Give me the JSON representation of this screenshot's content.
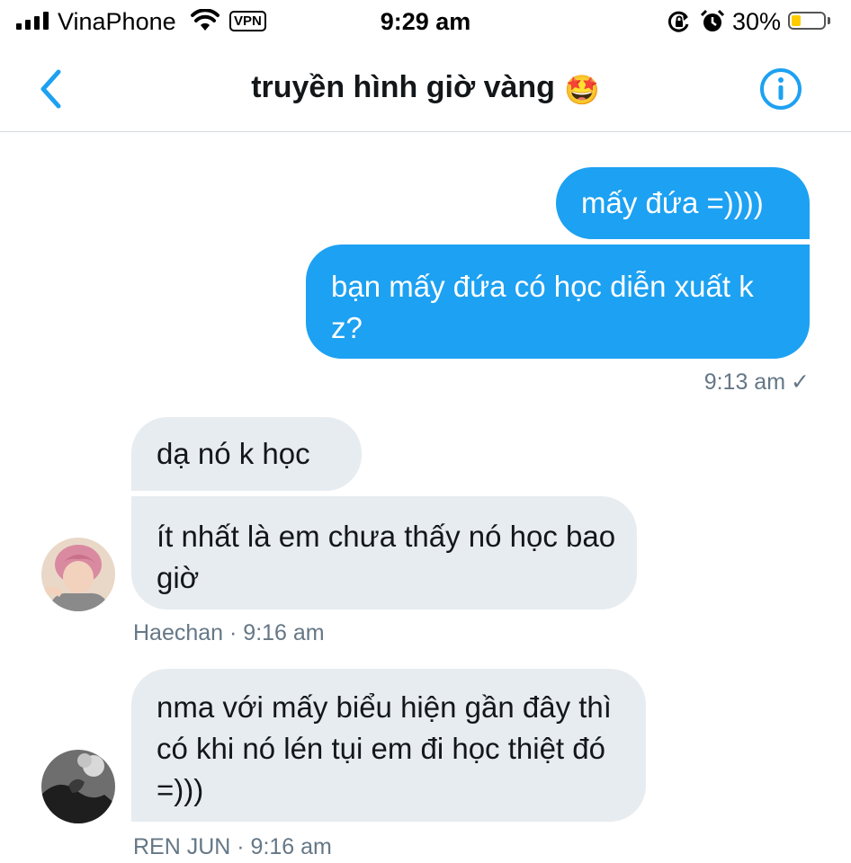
{
  "status_bar": {
    "carrier": "VinaPhone",
    "vpn": "VPN",
    "time": "9:29 am",
    "battery": "30%",
    "battery_level": 0.3,
    "icons": [
      "signal-icon",
      "wifi-icon",
      "orientation-lock-icon",
      "alarm-icon",
      "battery-icon"
    ]
  },
  "header": {
    "title": "truyền hình giờ vàng",
    "title_emoji": "🤩",
    "back_icon": "chevron-left-icon",
    "info_icon": "info-icon"
  },
  "colors": {
    "accent": "#1da1f2",
    "incoming_bubble": "#e6ecf0",
    "meta_text": "#657786"
  },
  "messages": {
    "outgoing": [
      {
        "text": "mấy đứa =))))"
      },
      {
        "text": "bạn mấy đứa có học diễn xuất k z?"
      }
    ],
    "outgoing_meta": {
      "time": "9:13 am",
      "status": "✓"
    },
    "haechan": [
      {
        "text": "dạ nó k học"
      },
      {
        "text": "ít nhất là em chưa thấy nó học bao giờ"
      }
    ],
    "haechan_meta": "Haechan · 9:16 am",
    "renjun": [
      {
        "text": "nma với mấy biểu hiện gần đây thì có khi nó lén tụi em đi học thiệt đó =)))"
      }
    ],
    "renjun_meta": "REN JUN · 9:16 am"
  }
}
